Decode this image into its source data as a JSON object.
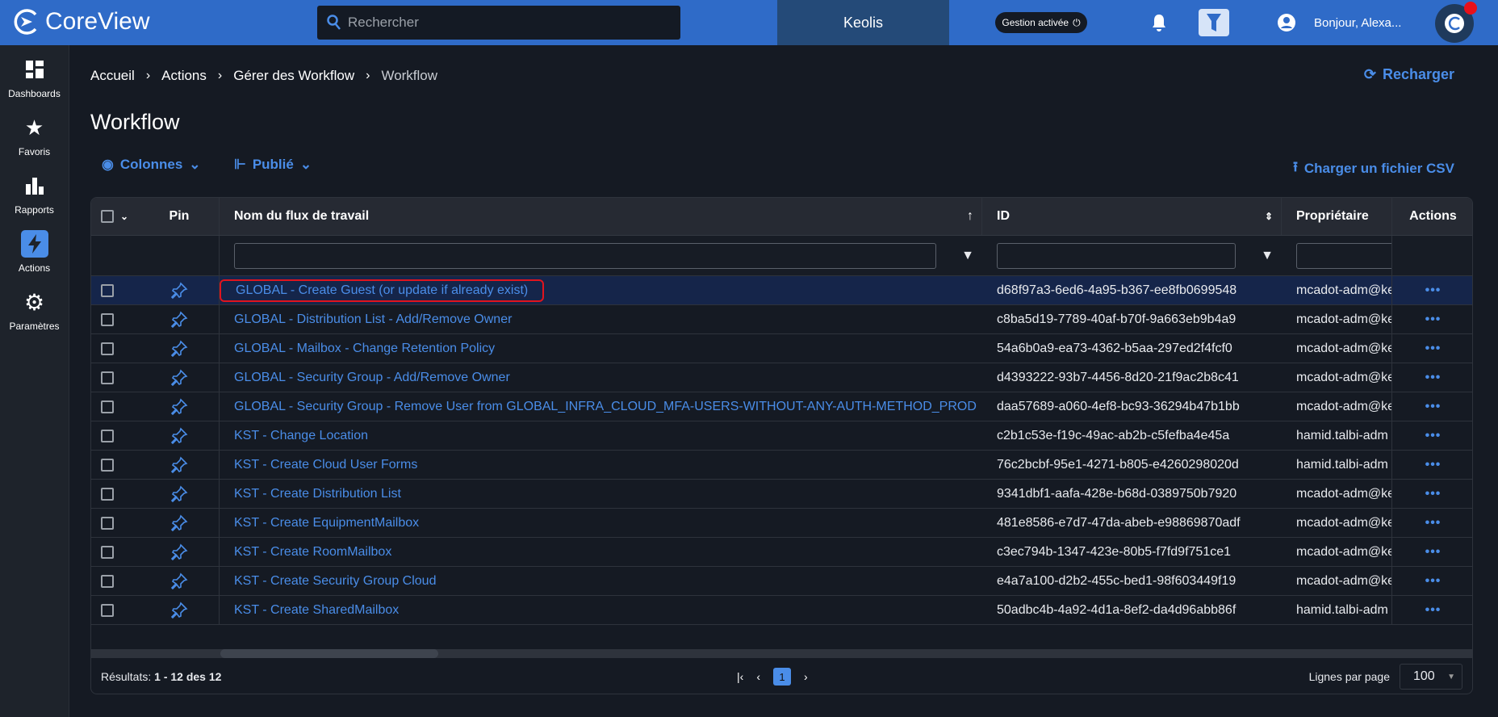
{
  "app": {
    "brand": "CoreView",
    "search_placeholder": "Rechercher",
    "tenant": "Keolis",
    "gestion": "Gestion activée",
    "greeting": "Bonjour, Alexa..."
  },
  "sidebar": [
    {
      "label": "Dashboards",
      "icon": "dashboard-icon"
    },
    {
      "label": "Favoris",
      "icon": "star-icon"
    },
    {
      "label": "Rapports",
      "icon": "bar-chart-icon"
    },
    {
      "label": "Actions",
      "icon": "bolt-icon"
    },
    {
      "label": "Paramètres",
      "icon": "gear-icon"
    }
  ],
  "breadcrumb": [
    "Accueil",
    "Actions",
    "Gérer des Workflow",
    "Workflow"
  ],
  "reload": "Recharger",
  "title": "Workflow",
  "toolbar": {
    "columns": "Colonnes",
    "published": "Publié",
    "upload": "Charger un fichier CSV"
  },
  "table": {
    "headers": {
      "pin": "Pin",
      "name": "Nom du flux de travail",
      "id": "ID",
      "owner": "Propriétaire",
      "actions": "Actions"
    },
    "rows": [
      {
        "name": "GLOBAL - Create Guest (or update if already exist)",
        "id": "d68f97a3-6ed6-4a95-b367-ee8fb0699548",
        "owner": "mcadot-adm@ke"
      },
      {
        "name": "GLOBAL - Distribution List - Add/Remove Owner",
        "id": "c8ba5d19-7789-40af-b70f-9a663eb9b4a9",
        "owner": "mcadot-adm@ke"
      },
      {
        "name": "GLOBAL - Mailbox - Change Retention Policy",
        "id": "54a6b0a9-ea73-4362-b5aa-297ed2f4fcf0",
        "owner": "mcadot-adm@ke"
      },
      {
        "name": "GLOBAL - Security Group - Add/Remove Owner",
        "id": "d4393222-93b7-4456-8d20-21f9ac2b8c41",
        "owner": "mcadot-adm@ke"
      },
      {
        "name": "GLOBAL - Security Group - Remove User from GLOBAL_INFRA_CLOUD_MFA-USERS-WITHOUT-ANY-AUTH-METHOD_PROD",
        "id": "daa57689-a060-4ef8-bc93-36294b47b1bb",
        "owner": "mcadot-adm@ke"
      },
      {
        "name": "KST - Change Location",
        "id": "c2b1c53e-f19c-49ac-ab2b-c5fefba4e45a",
        "owner": "hamid.talbi-adm"
      },
      {
        "name": "KST - Create Cloud User Forms",
        "id": "76c2bcbf-95e1-4271-b805-e4260298020d",
        "owner": "hamid.talbi-adm"
      },
      {
        "name": "KST - Create Distribution List",
        "id": "9341dbf1-aafa-428e-b68d-0389750b7920",
        "owner": "mcadot-adm@ke"
      },
      {
        "name": "KST - Create EquipmentMailbox",
        "id": "481e8586-e7d7-47da-abeb-e98869870adf",
        "owner": "mcadot-adm@ke"
      },
      {
        "name": "KST - Create RoomMailbox",
        "id": "c3ec794b-1347-423e-80b5-f7fd9f751ce1",
        "owner": "mcadot-adm@ke"
      },
      {
        "name": "KST - Create Security Group Cloud",
        "id": "e4a7a100-d2b2-455c-bed1-98f603449f19",
        "owner": "mcadot-adm@ke"
      },
      {
        "name": "KST - Create SharedMailbox",
        "id": "50adbc4b-4a92-4d1a-8ef2-da4d96abb86f",
        "owner": "hamid.talbi-adm"
      }
    ]
  },
  "footer": {
    "results_label": "Résultats:",
    "results_value": "1 - 12 des 12",
    "page": "1",
    "rows_per_page_label": "Lignes par page",
    "rows_per_page": "100"
  }
}
